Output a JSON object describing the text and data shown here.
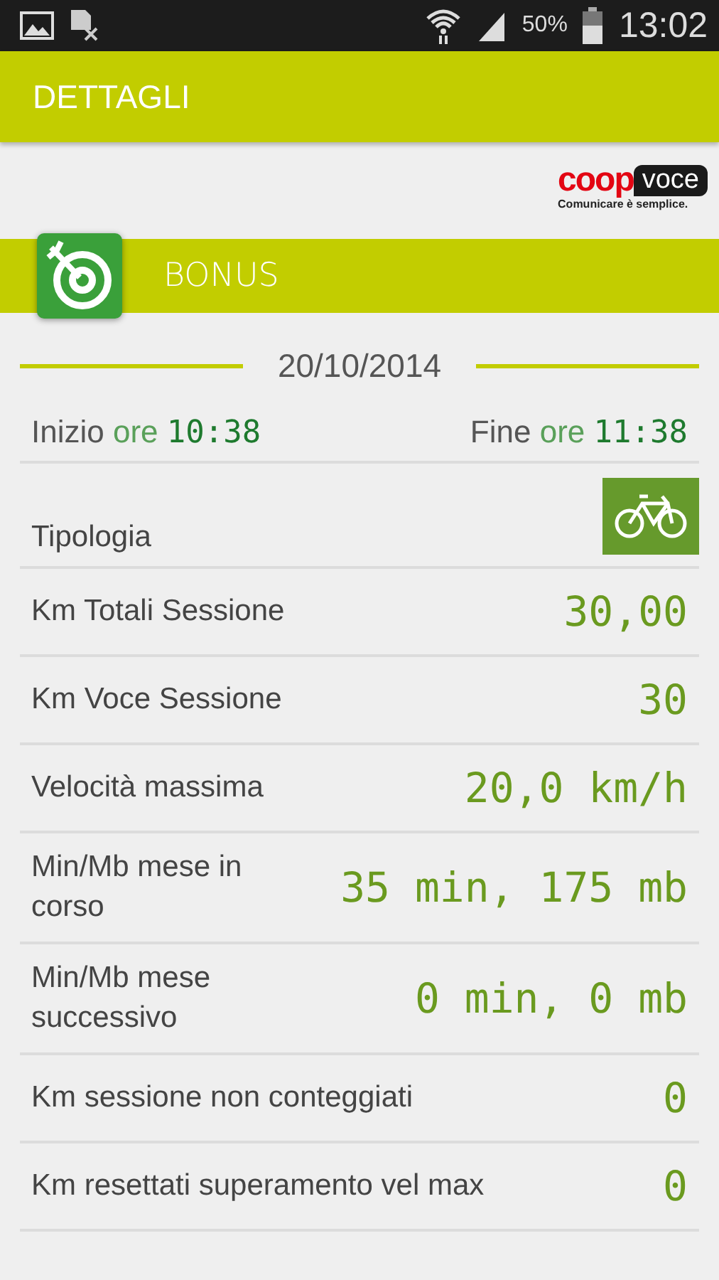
{
  "status_bar": {
    "battery": "50%",
    "time": "13:02"
  },
  "header": {
    "title": "DETTAGLI"
  },
  "logo": {
    "brand_left": "coop",
    "brand_right": "voce",
    "tagline": "Comunicare è semplice."
  },
  "section": {
    "title": "BONUS"
  },
  "date": "20/10/2014",
  "times": [
    {
      "label": "Inizio",
      "unit": "ore",
      "value": "10:38"
    },
    {
      "label": "Fine",
      "unit": "ore",
      "value": "11:38"
    }
  ],
  "rows": [
    {
      "kind": "icon",
      "label": "Tipologia"
    },
    {
      "kind": "value",
      "label": "Km Totali Sessione",
      "value": "30,00"
    },
    {
      "kind": "value",
      "label": "Km Voce Sessione",
      "value": "30"
    },
    {
      "kind": "value",
      "label": "Velocità massima",
      "value": "20,0 km/h"
    },
    {
      "kind": "value",
      "label": "Min/Mb mese in corso",
      "value": "35 min, 175 mb"
    },
    {
      "kind": "value",
      "label": "Min/Mb mese successivo",
      "value": "0 min, 0 mb"
    },
    {
      "kind": "value",
      "label": "Km sessione non conteggiati",
      "value": "0"
    },
    {
      "kind": "value",
      "label": "Km resettati superamento vel max",
      "value": "0"
    }
  ]
}
